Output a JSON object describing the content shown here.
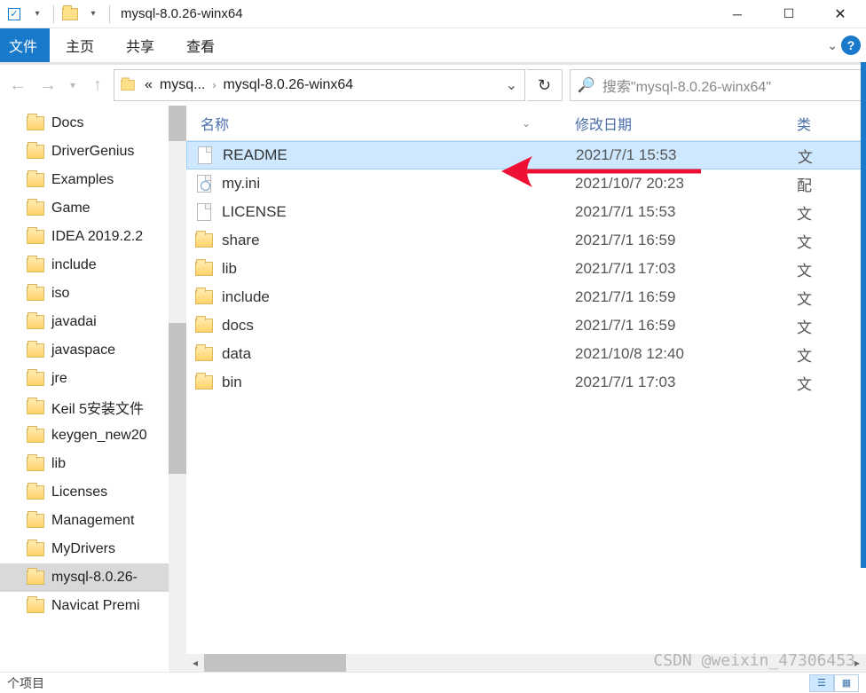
{
  "title": "mysql-8.0.26-winx64",
  "ribbon": {
    "file": "文件",
    "tabs": [
      "主页",
      "共享",
      "查看"
    ]
  },
  "breadcrumb": {
    "ellipsis": "«",
    "items": [
      "mysq...",
      "mysql-8.0.26-winx64"
    ]
  },
  "search": {
    "placeholder": "搜索\"mysql-8.0.26-winx64\""
  },
  "tree": {
    "items": [
      {
        "label": "Docs"
      },
      {
        "label": "DriverGenius"
      },
      {
        "label": "Examples"
      },
      {
        "label": "Game"
      },
      {
        "label": "IDEA 2019.2.2"
      },
      {
        "label": "include"
      },
      {
        "label": "iso"
      },
      {
        "label": "javadai"
      },
      {
        "label": "javaspace"
      },
      {
        "label": "jre"
      },
      {
        "label": "Keil 5安装文件"
      },
      {
        "label": "keygen_new20"
      },
      {
        "label": "lib"
      },
      {
        "label": "Licenses"
      },
      {
        "label": "Management"
      },
      {
        "label": "MyDrivers"
      },
      {
        "label": "mysql-8.0.26-",
        "selected": true
      },
      {
        "label": "Navicat Premi"
      }
    ]
  },
  "columns": {
    "name": "名称",
    "date": "修改日期",
    "type": "类"
  },
  "files": [
    {
      "name": "README",
      "date": "2021/7/1 15:53",
      "type": "文",
      "kind": "file",
      "selected": true
    },
    {
      "name": "my.ini",
      "date": "2021/10/7 20:23",
      "type": "配",
      "kind": "cfg"
    },
    {
      "name": "LICENSE",
      "date": "2021/7/1 15:53",
      "type": "文",
      "kind": "file"
    },
    {
      "name": "share",
      "date": "2021/7/1 16:59",
      "type": "文",
      "kind": "folder"
    },
    {
      "name": "lib",
      "date": "2021/7/1 17:03",
      "type": "文",
      "kind": "folder"
    },
    {
      "name": "include",
      "date": "2021/7/1 16:59",
      "type": "文",
      "kind": "folder"
    },
    {
      "name": "docs",
      "date": "2021/7/1 16:59",
      "type": "文",
      "kind": "folder"
    },
    {
      "name": "data",
      "date": "2021/10/8 12:40",
      "type": "文",
      "kind": "folder"
    },
    {
      "name": "bin",
      "date": "2021/7/1 17:03",
      "type": "文",
      "kind": "folder"
    }
  ],
  "status": {
    "text": "  个项目"
  },
  "watermark": "CSDN @weixin_47306453"
}
